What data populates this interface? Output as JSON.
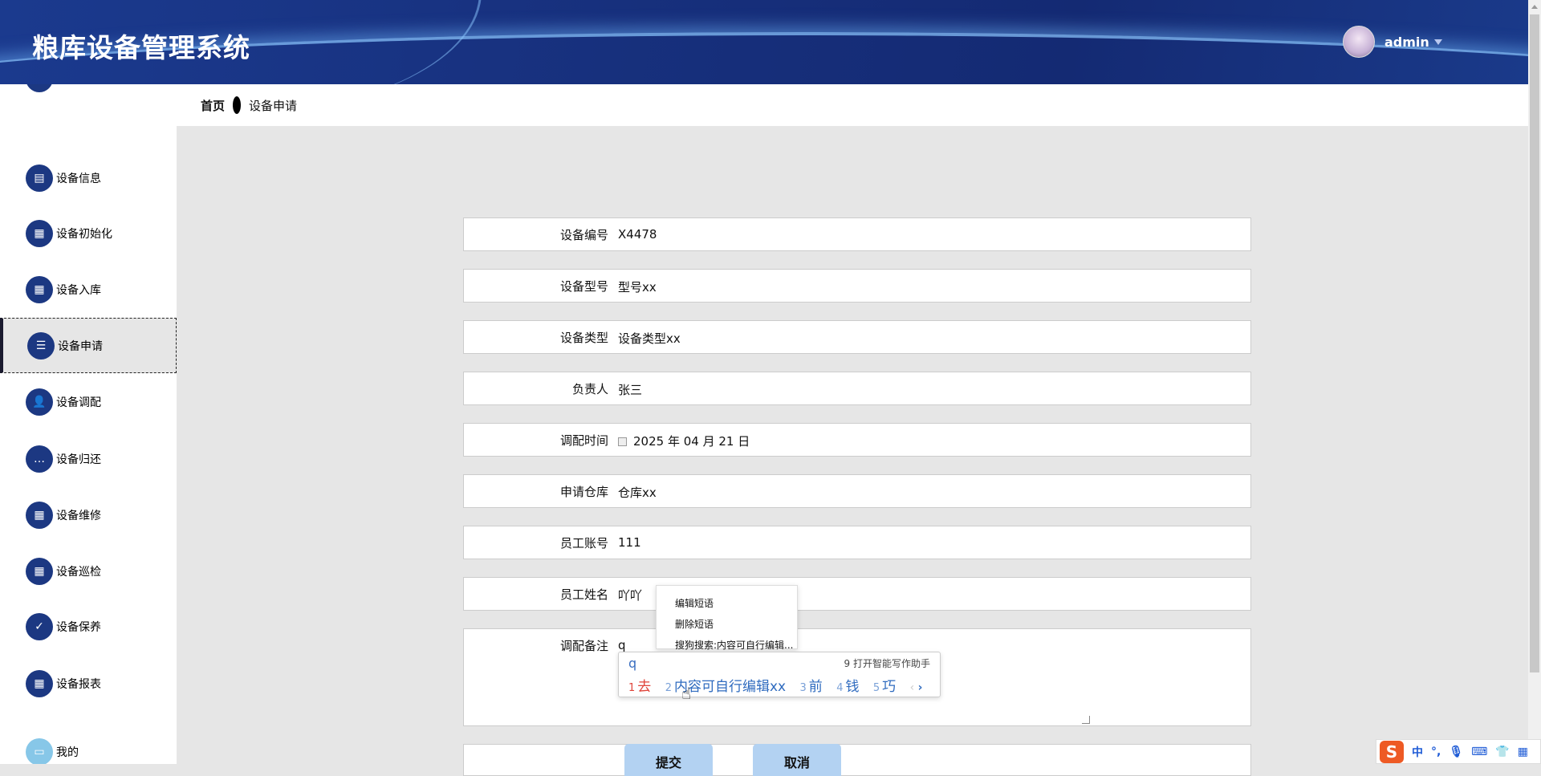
{
  "header": {
    "title": "粮库设备管理系统",
    "username": "admin"
  },
  "breadcrumb": {
    "home": "首页",
    "current": "设备申请"
  },
  "sidebar": {
    "items": [
      {
        "label": "设备信息",
        "icon": "clipboard-icon"
      },
      {
        "label": "设备初始化",
        "icon": "grid-icon"
      },
      {
        "label": "设备入库",
        "icon": "grid-icon"
      },
      {
        "label": "设备申请",
        "icon": "list-icon",
        "active": true
      },
      {
        "label": "设备调配",
        "icon": "user-icon"
      },
      {
        "label": "设备归还",
        "icon": "chat-icon"
      },
      {
        "label": "设备维修",
        "icon": "grid-icon"
      },
      {
        "label": "设备巡检",
        "icon": "grid-icon"
      },
      {
        "label": "设备保养",
        "icon": "check-icon"
      },
      {
        "label": "设备报表",
        "icon": "grid-icon"
      },
      {
        "label": "我的",
        "icon": "card-icon"
      }
    ]
  },
  "form": {
    "fields": [
      {
        "label": "设备编号",
        "value": "X4478"
      },
      {
        "label": "设备型号",
        "value": "型号xx"
      },
      {
        "label": "设备类型",
        "value": "设备类型xx"
      },
      {
        "label": "负责人",
        "value": "张三"
      },
      {
        "label": "调配时间",
        "value": "2025 年 04 月 21 日"
      },
      {
        "label": "申请仓库",
        "value": "仓库xx"
      },
      {
        "label": "员工账号",
        "value": "111"
      },
      {
        "label": "员工姓名",
        "value": "吖吖"
      },
      {
        "label": "调配备注",
        "value": "q"
      }
    ],
    "submit": "提交",
    "cancel": "取消"
  },
  "context_menu": [
    "编辑短语",
    "删除短语",
    "搜狗搜索:内容可自行编辑..."
  ],
  "ime": {
    "pinyin": "q",
    "hint": "9 打开智能写作助手",
    "candidates": [
      {
        "n": "1",
        "text": "去"
      },
      {
        "n": "2",
        "text": "内容可自行编辑xx"
      },
      {
        "n": "3",
        "text": "前"
      },
      {
        "n": "4",
        "text": "钱"
      },
      {
        "n": "5",
        "text": "巧"
      }
    ],
    "toolbar": {
      "logo": "S",
      "mode": "中",
      "punct": "°,"
    }
  }
}
